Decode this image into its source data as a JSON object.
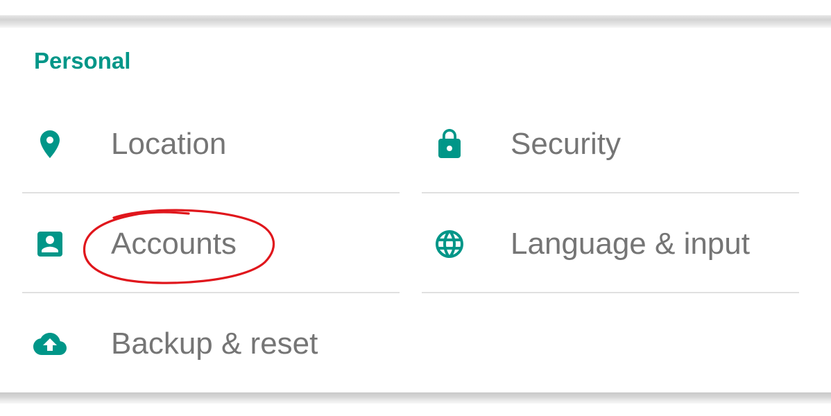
{
  "theme": {
    "accent": "#009688",
    "text": "#757575",
    "divider": "#e0e0e0",
    "annotation": "#e0161c"
  },
  "section": {
    "title": "Personal"
  },
  "items": [
    {
      "label": "Location",
      "icon": "location-pin-icon"
    },
    {
      "label": "Security",
      "icon": "lock-icon"
    },
    {
      "label": "Accounts",
      "icon": "account-box-icon"
    },
    {
      "label": "Language & input",
      "icon": "globe-icon"
    },
    {
      "label": "Backup & reset",
      "icon": "cloud-upload-icon"
    }
  ],
  "annotation": {
    "type": "hand-drawn-ellipse",
    "target": "Accounts",
    "color": "red"
  }
}
